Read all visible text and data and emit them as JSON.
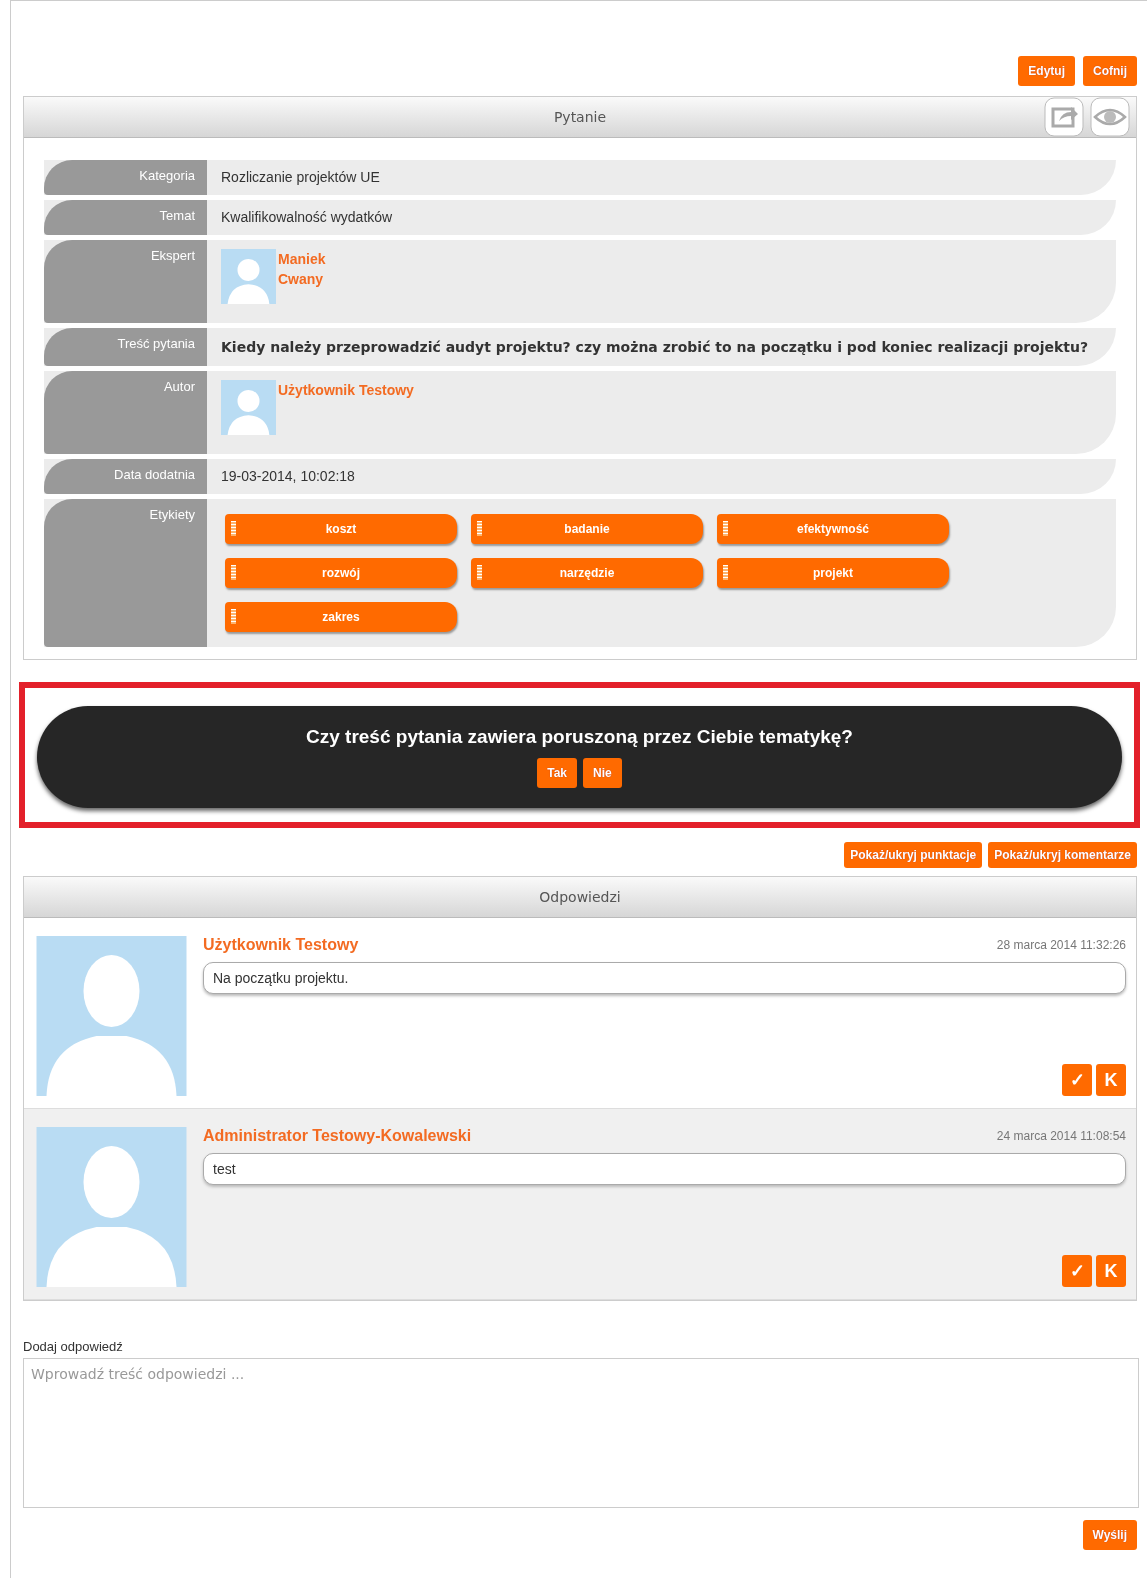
{
  "top_buttons": [
    "Edytuj",
    "Cofnij"
  ],
  "question_panel": {
    "title": "Pytanie",
    "fields": [
      {
        "kind": "text",
        "label": "Kategoria",
        "value": "Rozliczanie projektów UE"
      },
      {
        "kind": "text",
        "label": "Temat",
        "value": "Kwalifikowalność wydatków"
      },
      {
        "kind": "person",
        "label": "Ekspert",
        "name_lines": [
          "Maniek",
          "Cwany"
        ]
      },
      {
        "kind": "bold",
        "label": "Treść pytania",
        "value": "Kiedy należy przeprowadzić audyt projektu? czy można zrobić to na początku i pod koniec realizacji projektu?"
      },
      {
        "kind": "person",
        "label": "Autor",
        "name_lines": [
          "Użytkownik Testowy"
        ]
      },
      {
        "kind": "text",
        "label": "Data dodatnia",
        "value": "19-03-2014, 10:02:18"
      },
      {
        "kind": "tags",
        "label": "Etykiety",
        "tags": [
          "koszt",
          "badanie",
          "efektywność",
          "rozwój",
          "narzędzie",
          "projekt",
          "zakres"
        ]
      }
    ]
  },
  "prompt": {
    "question": "Czy treść pytania zawiera poruszoną przez Ciebie tematykę?",
    "buttons": [
      "Tak",
      "Nie"
    ]
  },
  "toggle_buttons": [
    "Pokaż/ukryj punktacje",
    "Pokaż/ukryj komentarze"
  ],
  "answers_panel": {
    "title": "Odpowiedzi",
    "answers": [
      {
        "author": "Użytkownik Testowy",
        "date": "28 marca 2014 11:32:26",
        "text": "Na początku projektu.",
        "actions": [
          "✓",
          "K"
        ]
      },
      {
        "author": "Administrator Testowy-Kowalewski",
        "date": "24 marca 2014 11:08:54",
        "text": "test",
        "actions": [
          "✓",
          "K"
        ]
      }
    ]
  },
  "add_answer": {
    "label": "Dodaj odpowiedź",
    "placeholder": "Wprowadź treść odpowiedzi ...",
    "submit": "Wyślij"
  }
}
